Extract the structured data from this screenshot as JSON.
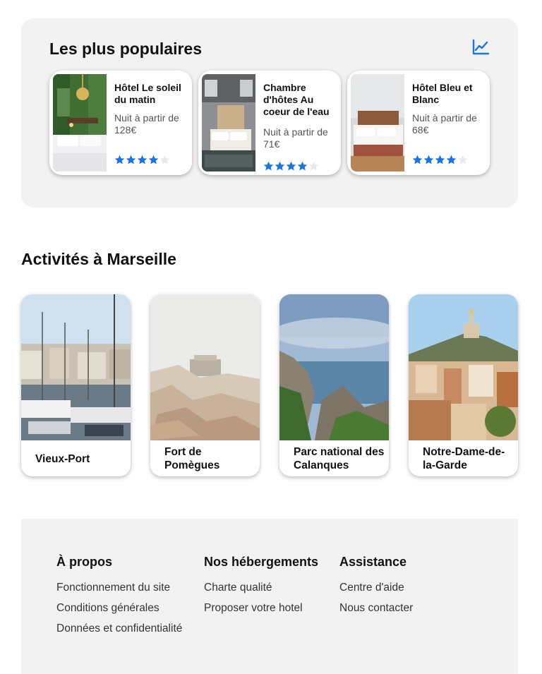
{
  "popular": {
    "title": "Les plus populaires",
    "icon": "trend-chart-icon",
    "accent": "#1a73e8",
    "hotels": [
      {
        "name": "Hôtel Le soleil du matin",
        "price": "Nuit à partir de 128€",
        "rating": 4,
        "max_rating": 5
      },
      {
        "name": "Chambre d'hôtes Au coeur de l'eau",
        "price": "Nuit à partir de 71€",
        "rating": 4,
        "max_rating": 5
      },
      {
        "name": "Hôtel Bleu et Blanc",
        "price": "Nuit à partir de 68€",
        "rating": 4,
        "max_rating": 5
      }
    ]
  },
  "activities": {
    "title": "Activités à Marseille",
    "items": [
      {
        "label": "Vieux-Port"
      },
      {
        "label": "Fort de Pomègues"
      },
      {
        "label": "Parc national des Calanques"
      },
      {
        "label": "Notre-Dame-de-la-Garde"
      }
    ]
  },
  "footer": {
    "columns": [
      {
        "heading": "À propos",
        "links": [
          "Fonctionnement du site",
          "Conditions générales",
          "Données et confidentialité"
        ]
      },
      {
        "heading": "Nos hébergements",
        "links": [
          "Charte qualité",
          "Proposer votre hotel"
        ]
      },
      {
        "heading": "Assistance",
        "links": [
          "Centre d'aide",
          "Nous contacter"
        ]
      }
    ]
  }
}
